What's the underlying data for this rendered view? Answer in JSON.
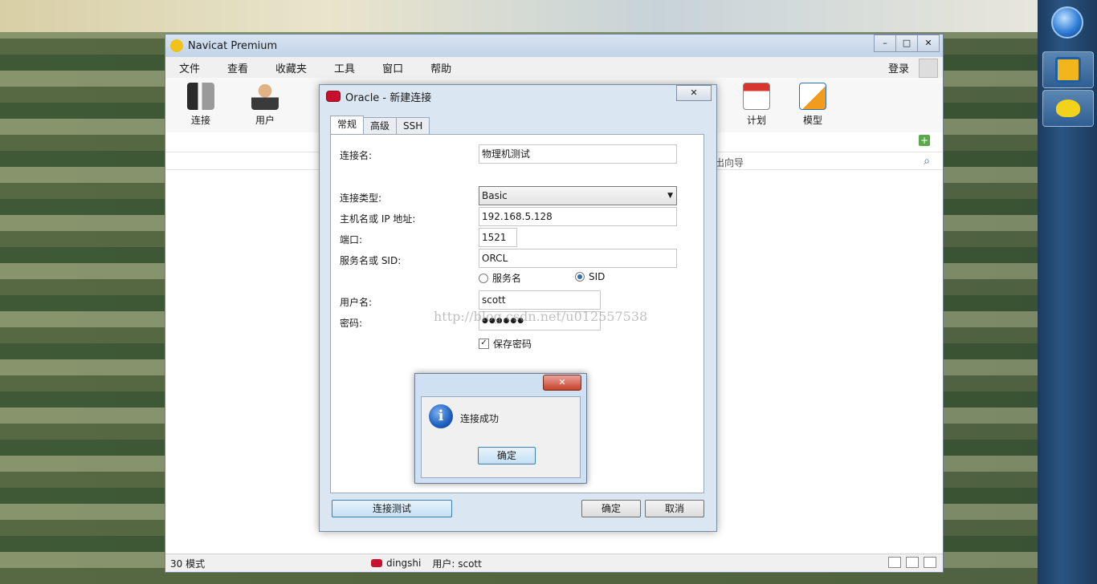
{
  "window": {
    "title": "Navicat Premium"
  },
  "menu": {
    "items": [
      "文件",
      "查看",
      "收藏夹",
      "工具",
      "窗口",
      "帮助"
    ],
    "login": "登录"
  },
  "toolbar": {
    "connect": "连接",
    "user": "用户",
    "schedule": "计划",
    "model": "模型"
  },
  "content": {
    "wizard_label": "出向导"
  },
  "status_bar": {
    "object_count": "30 模式",
    "connection": "dingshi",
    "user": "用户: scott"
  },
  "dialog": {
    "title": "Oracle - 新建连接",
    "tabs": [
      "常规",
      "高级",
      "SSH"
    ],
    "labels": {
      "connection_name": "连接名:",
      "connection_type": "连接类型:",
      "host": "主机名或 IP 地址:",
      "port": "端口:",
      "service": "服务名或 SID:",
      "username": "用户名:",
      "password": "密码:"
    },
    "values": {
      "connection_name": "物理机测试",
      "connection_type": "Basic",
      "host": "192.168.5.128",
      "port": "1521",
      "service": "ORCL",
      "username": "scott",
      "password": "●●●●●●"
    },
    "radio_service": "服务名",
    "radio_sid": "SID",
    "save_password": "保存密码",
    "test_button": "连接测试",
    "ok_button": "确定",
    "cancel_button": "取消",
    "watermark": "http://blog.csdn.net/u012557538"
  },
  "message_box": {
    "text": "连接成功",
    "ok_button": "确定"
  }
}
